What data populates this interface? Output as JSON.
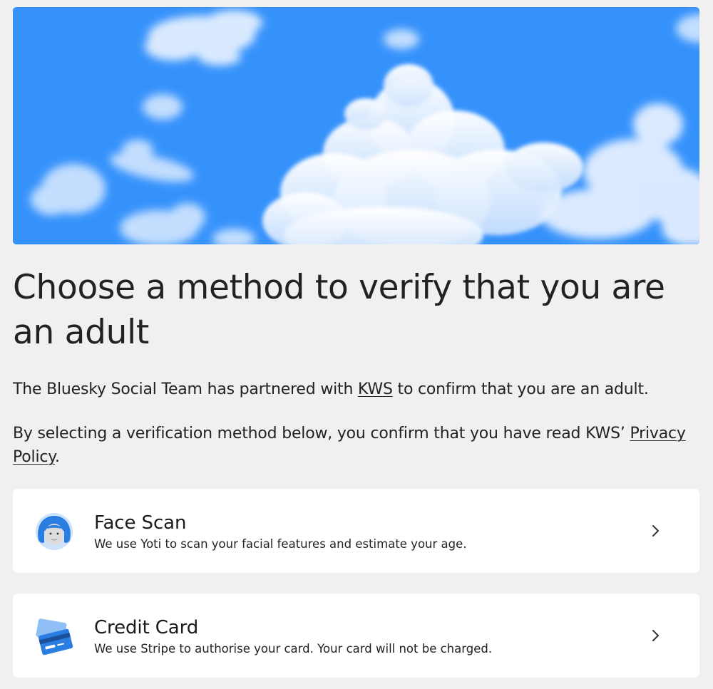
{
  "hero": {
    "image": "sky-with-clouds",
    "color_sky": "#3a93fb"
  },
  "heading": "Choose a method to verify that you are an adult",
  "intro": {
    "before_link": "The Bluesky Social Team has partnered with ",
    "link": "KWS",
    "after_link": " to confirm that you are an adult."
  },
  "consent": {
    "before_link": "By selecting a verification method below, you confirm that you have read KWS’ ",
    "link": "Privacy Policy",
    "after_link": "."
  },
  "methods": [
    {
      "icon": "face-icon",
      "title": "Face Scan",
      "description": "We use Yoti to scan your facial features and estimate your age."
    },
    {
      "icon": "credit-card-icon",
      "title": "Credit Card",
      "description": "We use Stripe to authorise your card. Your card will not be charged."
    }
  ],
  "colors": {
    "accent": "#2a7de1",
    "background": "#f0f0f0",
    "card": "#ffffff"
  }
}
